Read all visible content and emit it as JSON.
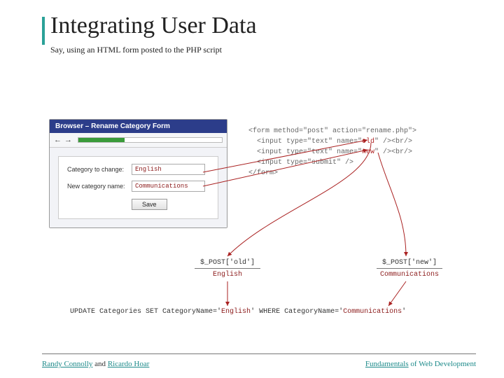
{
  "title": "Integrating User Data",
  "subtitle": "Say, using an HTML form posted to the PHP script",
  "browser": {
    "window_title": "Browser – Rename Category Form",
    "nav_back": "←",
    "nav_fwd": "→",
    "fields": {
      "label_old": "Category to change:",
      "value_old": "English",
      "label_new": "New category name:",
      "value_new": "Communications"
    },
    "save_label": "Save"
  },
  "code": {
    "l1a": "<form method=\"post\" action=\"rename.php\">",
    "l2a": "  <input type=\"text\" name=\"",
    "l2b": "old",
    "l2c": "\" /><br/>",
    "l3a": "  <input type=\"text\" name=\"",
    "l3b": "new",
    "l3c": "\" /><br/>",
    "l4a": "  <input type=\"submit\" />",
    "l5a": "</form>"
  },
  "php": {
    "old_label": "$_POST['old']",
    "old_value": "English",
    "new_label": "$_POST['new']",
    "new_value": "Communications"
  },
  "sql": {
    "p1": "UPDATE Categories SET CategoryName='",
    "v1": "English",
    "p2": "' WHERE CategoryName='",
    "v2": "Communications",
    "p3": "'"
  },
  "footer": {
    "author1": "Randy Connolly",
    "conj": " and ",
    "author2": "Ricardo Hoar",
    "book1": "Fundamentals",
    "book2": " of Web Development"
  }
}
